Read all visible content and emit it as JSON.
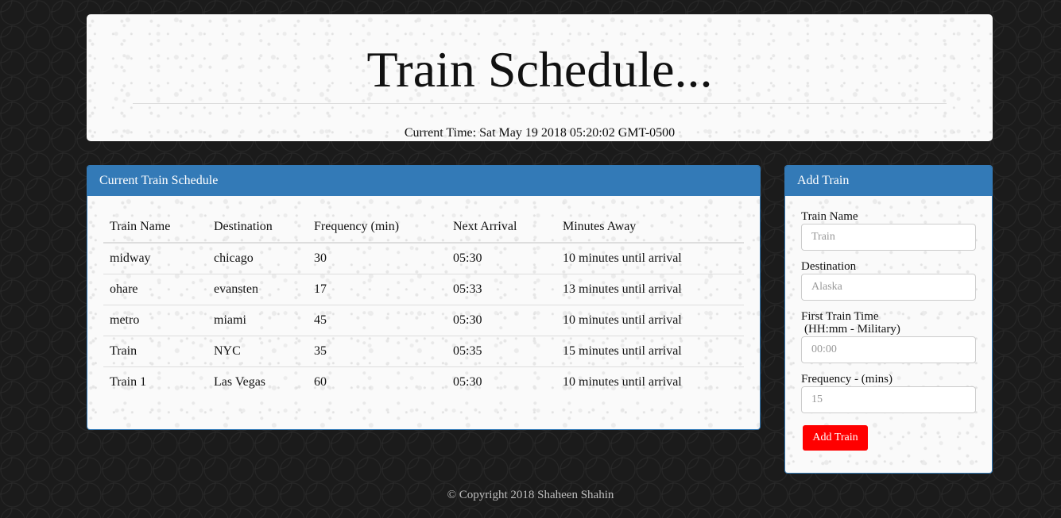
{
  "header": {
    "title": "Train Schedule...",
    "current_time_label": "Current Time: Sat May 19 2018 05:20:02 GMT-0500"
  },
  "schedule": {
    "heading": "Current Train Schedule",
    "columns": [
      "Train Name",
      "Destination",
      "Frequency (min)",
      "Next Arrival",
      "Minutes Away"
    ],
    "rows": [
      [
        "midway",
        "chicago",
        "30",
        "05:30",
        "10 minutes until arrival"
      ],
      [
        "ohare",
        "evansten",
        "17",
        "05:33",
        "13 minutes until arrival"
      ],
      [
        "metro",
        "miami",
        "45",
        "05:30",
        "10 minutes until arrival"
      ],
      [
        "Train",
        "NYC",
        "35",
        "05:35",
        "15 minutes until arrival"
      ],
      [
        "Train 1",
        "Las Vegas",
        "60",
        "05:30",
        "10 minutes until arrival"
      ]
    ]
  },
  "add_train": {
    "heading": "Add Train",
    "train_name_label": "Train Name",
    "train_name_placeholder": "Train",
    "destination_label": "Destination",
    "destination_placeholder": "Alaska",
    "first_time_label": "First Train Time",
    "first_time_sub": "(HH:mm - Military)",
    "first_time_placeholder": "00:00",
    "frequency_label": "Frequency - (mins)",
    "frequency_placeholder": "15",
    "submit_label": "Add Train"
  },
  "footer": {
    "text": "© Copyright 2018 Shaheen Shahin"
  },
  "colors": {
    "panel_primary": "#337ab7",
    "button_add": "#ff0000"
  }
}
